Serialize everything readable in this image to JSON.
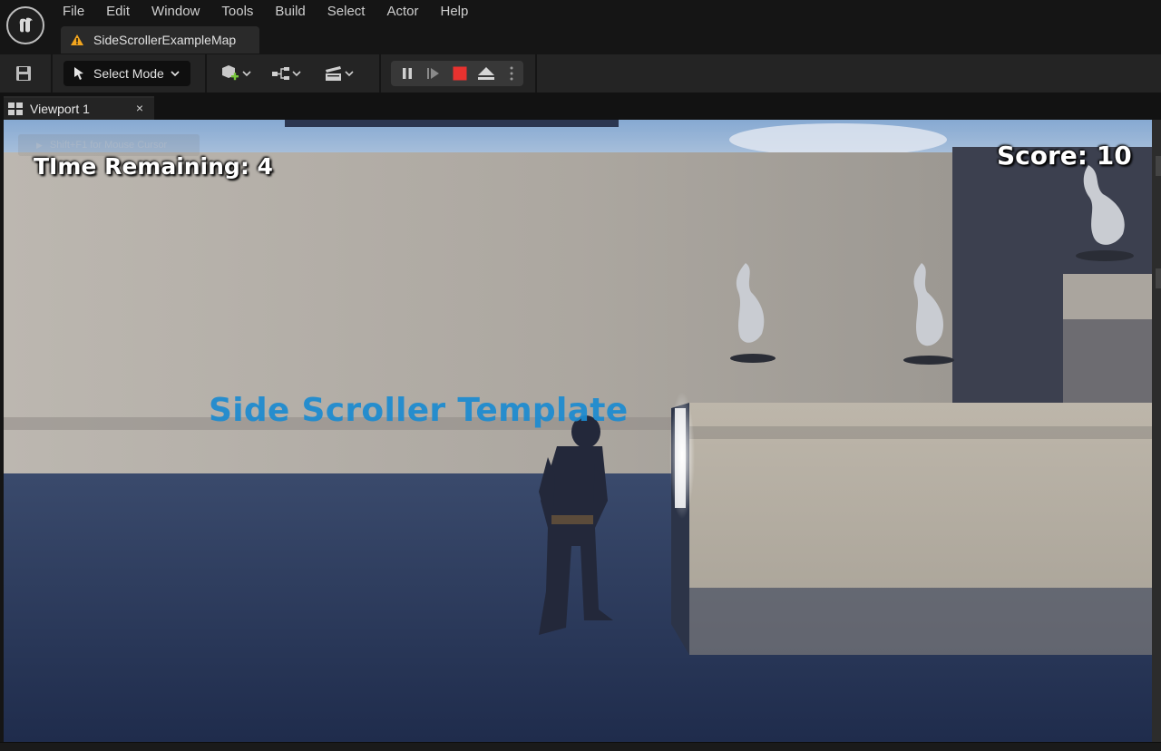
{
  "menu": {
    "items": [
      "File",
      "Edit",
      "Window",
      "Tools",
      "Build",
      "Select",
      "Actor",
      "Help"
    ]
  },
  "document_tab": {
    "label": "SideScrollerExampleMap",
    "icon": "warning-icon"
  },
  "toolbar": {
    "save_icon": "save-icon",
    "select_mode_label": "Select Mode",
    "buttons": [
      "add-actor-icon",
      "blueprint-icon",
      "cinematics-icon"
    ],
    "play_controls": [
      "pause-icon",
      "advance-frame-icon",
      "stop-icon",
      "eject-icon",
      "more-options-icon"
    ],
    "stop_color": "#e8322f"
  },
  "viewport_tab": {
    "label": "Viewport 1",
    "close": "×",
    "icon": "viewport-layout-icon"
  },
  "viewport": {
    "hint": "Shift+F1 for Mouse Cursor",
    "hud_time": "TIme Remaining: 4",
    "hud_score": "Score: 10",
    "world_text": "Side Scroller Template",
    "world_text_color": "#1b8bd1"
  }
}
